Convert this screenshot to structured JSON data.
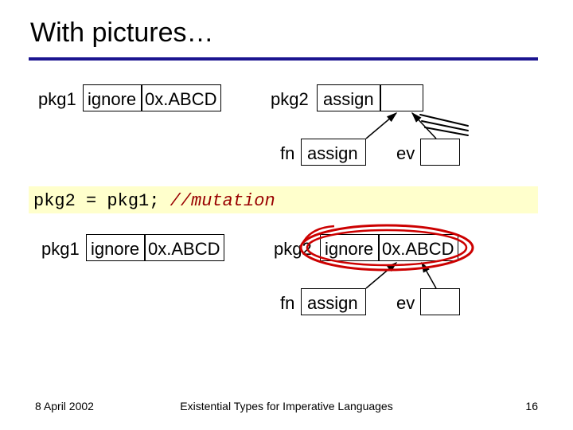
{
  "title": "With pictures…",
  "row1": {
    "pkg1_label": "pkg1",
    "pkg1_box1": "ignore",
    "pkg1_box2": "0x.ABCD",
    "pkg2_label": "pkg2",
    "pkg2_box1": "assign",
    "fn_label": "fn",
    "fn_box": "assign",
    "ev_label": "ev"
  },
  "codeline": {
    "stmt": "pkg2 = pkg1; ",
    "comment": "//mutation"
  },
  "row2": {
    "pkg1_label": "pkg1",
    "pkg1_box1": "ignore",
    "pkg1_box2": "0x.ABCD",
    "pkg2_label": "pkg2",
    "pkg2_box1": "ignore",
    "pkg2_box2": "0x.ABCD",
    "fn_label": "fn",
    "fn_box": "assign",
    "ev_label": "ev"
  },
  "footer": {
    "date": "8 April 2002",
    "center": "Existential Types for Imperative Languages",
    "pagenum": "16"
  },
  "colors": {
    "rule": "#1b1490",
    "codebg": "#ffffcc",
    "comment": "#990000",
    "highlight": "#cc0000"
  }
}
